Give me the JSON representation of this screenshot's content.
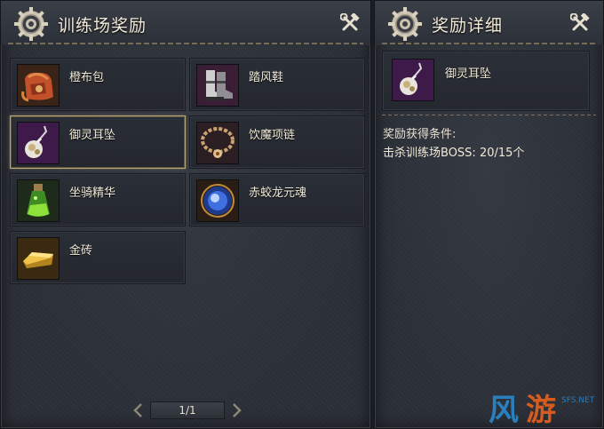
{
  "left_panel": {
    "title": "训练场奖励",
    "tools_icon": "crossed-hammer-wrench-icon",
    "items": [
      {
        "name": "橙布包",
        "icon": "orange-cloth-bag-icon"
      },
      {
        "name": "踏风鞋",
        "icon": "wind-boots-icon"
      },
      {
        "name": "御灵耳坠",
        "icon": "spirit-earring-icon",
        "selected": true
      },
      {
        "name": "饮魔项链",
        "icon": "demon-necklace-icon"
      },
      {
        "name": "坐骑精华",
        "icon": "mount-essence-potion-icon"
      },
      {
        "name": "赤蛟龙元魂",
        "icon": "dragon-soul-orb-icon"
      },
      {
        "name": "金砖",
        "icon": "gold-brick-icon"
      }
    ],
    "pagination": {
      "label": "1/1"
    }
  },
  "right_panel": {
    "title": "奖励详细",
    "tools_icon": "crossed-hammer-wrench-icon",
    "selected_item": {
      "name": "御灵耳坠",
      "icon": "spirit-earring-icon"
    },
    "condition_label": "奖励获得条件:",
    "condition_text": "击杀训练场BOSS:  20/15个"
  },
  "watermark": {
    "text": "风游",
    "sub": "SFS.NET"
  },
  "colors": {
    "selected_border": "#b9a77a",
    "panel_bg": "#2b2f37",
    "text": "#f0ead8"
  }
}
